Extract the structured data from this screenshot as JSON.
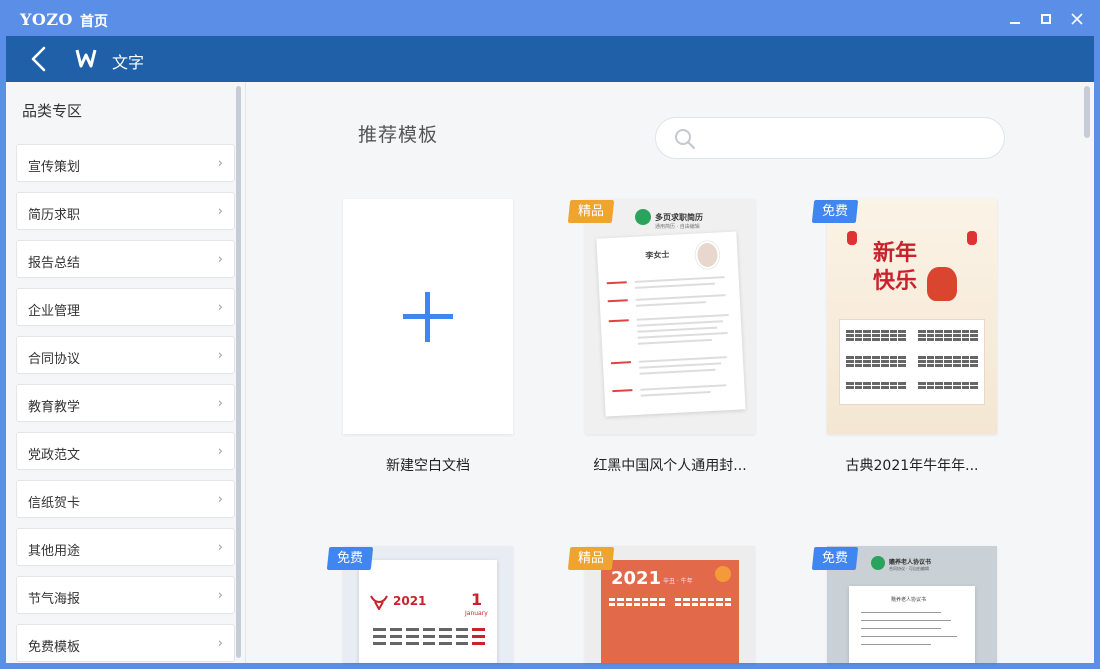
{
  "window": {
    "logo": "YOZO",
    "title": "首页"
  },
  "header": {
    "app_name": "文字"
  },
  "sidebar": {
    "title": "品类专区",
    "items": [
      {
        "label": "宣传策划"
      },
      {
        "label": "简历求职"
      },
      {
        "label": "报告总结"
      },
      {
        "label": "企业管理"
      },
      {
        "label": "合同协议"
      },
      {
        "label": "教育教学"
      },
      {
        "label": "党政范文"
      },
      {
        "label": "信纸贺卡"
      },
      {
        "label": "其他用途"
      },
      {
        "label": "节气海报"
      },
      {
        "label": "免费模板"
      }
    ],
    "chevron": "›"
  },
  "main": {
    "section_title": "推荐模板",
    "search": {
      "placeholder": ""
    },
    "templates": [
      {
        "label": "新建空白文档",
        "badge": ""
      },
      {
        "label": "红黑中国风个人通用封...",
        "badge": "精品",
        "resume": {
          "header": "多页求职简历",
          "sub": "通用简历 · 自由编辑",
          "name": "李女士"
        }
      },
      {
        "label": "古典2021年牛年年...",
        "badge": "免费",
        "poster": {
          "title1": "新年",
          "title2": "快乐"
        }
      },
      {
        "label": "",
        "badge": "免费",
        "cal": {
          "year": "2021",
          "month": "1",
          "month_name": "January"
        }
      },
      {
        "label": "",
        "badge": "精品",
        "cal": {
          "year": "2021",
          "sub": "辛丑 · 牛年"
        }
      },
      {
        "label": "",
        "badge": "免费",
        "doc": {
          "header": "赡养老人协议书",
          "sub": "合同协议 · 可自由编辑",
          "doc_title": "赡养老人协议书"
        }
      }
    ]
  },
  "colors": {
    "title_bar": "#5b8ee6",
    "header": "#2060a8",
    "badge_gold": "#f0a430",
    "badge_blue": "#3f86f0",
    "plus": "#3f86f0"
  }
}
